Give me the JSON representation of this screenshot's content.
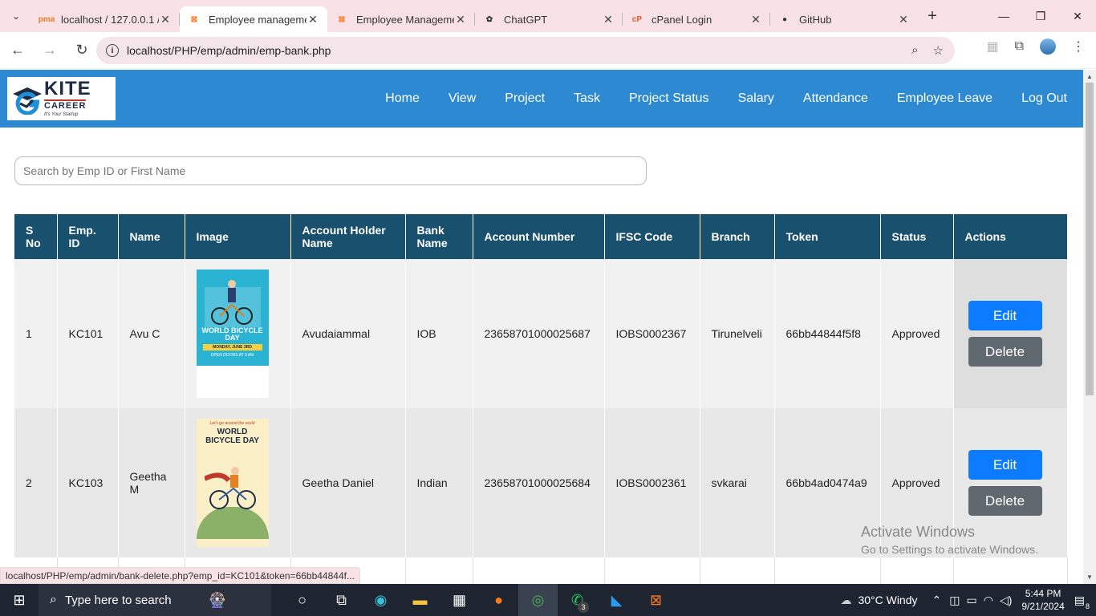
{
  "browser": {
    "tabs": [
      {
        "title": "localhost / 127.0.0.1 /",
        "icon": "phpmyadmin-icon"
      },
      {
        "title": "Employee manageme",
        "icon": "xampp-icon",
        "active": true
      },
      {
        "title": "Employee Manageme",
        "icon": "xampp-icon"
      },
      {
        "title": "ChatGPT",
        "icon": "chatgpt-icon"
      },
      {
        "title": "cPanel Login",
        "icon": "cpanel-icon"
      },
      {
        "title": "GitHub",
        "icon": "github-icon"
      }
    ],
    "url": "localhost/PHP/emp/admin/emp-bank.php",
    "status_url": "localhost/PHP/emp/admin/bank-delete.php?emp_id=KC101&token=66bb44844f..."
  },
  "header": {
    "logo_text": "KITE",
    "logo_sub": "CAREER",
    "logo_tag": "It's Your Startup",
    "nav": [
      "Home",
      "View",
      "Project",
      "Task",
      "Project Status",
      "Salary",
      "Attendance",
      "Employee Leave",
      "Log Out"
    ]
  },
  "search": {
    "placeholder": "Search by Emp ID or First Name"
  },
  "table": {
    "headers": [
      "S No",
      "Emp. ID",
      "Name",
      "Image",
      "Account Holder Name",
      "Bank Name",
      "Account Number",
      "IFSC Code",
      "Branch",
      "Token",
      "Status",
      "Actions"
    ],
    "rows": [
      {
        "sno": "1",
        "emp_id": "KC101",
        "name": "Avu C",
        "image_text": "WORLD BICYCLE DAY",
        "image_sub": "MONDAY, JUNE 3RD",
        "image_foot": "OPEN DOORS AT 9 AM",
        "holder": "Avudaiammal",
        "bank": "IOB",
        "account": "23658701000025687",
        "ifsc": "IOBS0002367",
        "branch": "Tirunelveli",
        "token": "66bb44844f5f8",
        "status": "Approved"
      },
      {
        "sno": "2",
        "emp_id": "KC103",
        "name": "Geetha M",
        "image_text": "WORLD BICYCLE DAY",
        "image_sub": "Let's go around the world",
        "holder": "Geetha Daniel",
        "bank": "Indian",
        "account": "23658701000025684",
        "ifsc": "IOBS0002361",
        "branch": "svkarai",
        "token": "66bb4ad0474a9",
        "status": "Approved"
      }
    ],
    "edit_label": "Edit",
    "delete_label": "Delete"
  },
  "watermark": {
    "title": "Activate Windows",
    "subtitle": "Go to Settings to activate Windows."
  },
  "taskbar": {
    "search_placeholder": "Type here to search",
    "weather": "30°C  Windy",
    "time": "5:44 PM",
    "date": "9/21/2024",
    "notification_count": "8",
    "whatsapp_badge": "3"
  },
  "colors": {
    "header": "#2d89d1",
    "table_head": "#18506e",
    "edit": "#0d7bff",
    "delete": "#606970"
  }
}
